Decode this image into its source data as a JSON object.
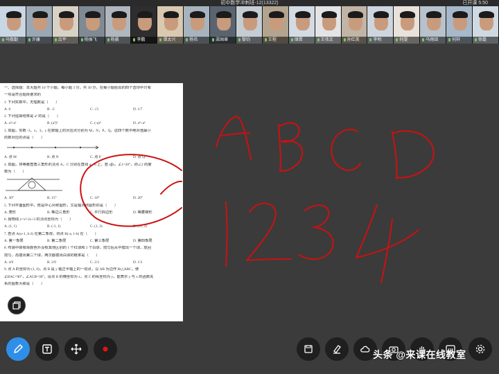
{
  "header": {
    "title": "初中数学冲刺班-12(13322)",
    "timer": "已开课 5:50"
  },
  "participants": [
    {
      "name": "马敬勤",
      "bg": "#c9d6e3"
    },
    {
      "name": "许康",
      "bg": "#9aa7b5"
    },
    {
      "name": "吕平",
      "bg": "#d8d2c6"
    },
    {
      "name": "杨振飞",
      "bg": "#7f8a94"
    },
    {
      "name": "杨晨",
      "bg": "#b0b7bf"
    },
    {
      "name": "李鹏",
      "bg": "#2e2e2e"
    },
    {
      "name": "谭太兴",
      "bg": "#d9c9b0"
    },
    {
      "name": "杨伟",
      "bg": "#a7b3be"
    },
    {
      "name": "梁国章",
      "bg": "#5a6470"
    },
    {
      "name": "黎钧",
      "bg": "#c4ccd4"
    },
    {
      "name": "王程",
      "bg": "#b2a48f"
    },
    {
      "name": "储晋",
      "bg": "#d3dbe3"
    },
    {
      "name": "王伟文",
      "bg": "#e2e4e6"
    },
    {
      "name": "孙红英",
      "bg": "#c2b5a5"
    },
    {
      "name": "李明",
      "bg": "#cdd6df"
    },
    {
      "name": "何雯",
      "bg": "#e8e2da"
    },
    {
      "name": "马雨田",
      "bg": "#b7c2cc"
    },
    {
      "name": "何轩",
      "bg": "#a6b8c9"
    },
    {
      "name": "徐磊",
      "bg": "#cfd9e2"
    }
  ],
  "document": {
    "lines": [
      {
        "t": "text",
        "v": "一、选择题：本大题共 10 个小题，每小题 3 分，共 30 分，在每小题给出的四个选项中只有"
      },
      {
        "t": "text",
        "v": "一项是符合题目要求的"
      },
      {
        "t": "text",
        "v": "1. 下列实数中，无理数是（　　）"
      },
      {
        "t": "opts",
        "v": [
          "A. 0",
          "B. -2",
          "C. √3",
          "D. 1/7"
        ]
      },
      {
        "t": "text",
        "v": "2. 下列运算结果是 a⁶ 的是（　　）"
      },
      {
        "t": "opts",
        "v": [
          "A. a³+a³",
          "B. (a³)²",
          "C. (-a)⁴",
          "D. a⁸÷a²"
        ]
      },
      {
        "t": "text",
        "v": "3. 如图，实数 -3，x，3，y 在数轴上的对应点分别为 M，N，P，Q，这四个数中绝对值最小"
      },
      {
        "t": "text",
        "v": "的数对应的点是（　　）"
      },
      {
        "t": "fig1",
        "v": ""
      },
      {
        "t": "opts",
        "v": [
          "A. 点 M",
          "B. 点 N",
          "C. 点 P",
          "D. 点 Q"
        ]
      },
      {
        "t": "text",
        "v": "4. 如图，将等腰直角三角形的顶点 A，C 分别在直线 a，b 上，若 a∥b，∠1=30°，则∠2 的度"
      },
      {
        "t": "text",
        "v": "数为（　　）"
      },
      {
        "t": "fig2",
        "v": ""
      },
      {
        "t": "opts",
        "v": [
          "A. 30°",
          "B. 15°",
          "C. 10°",
          "D. 20°"
        ]
      },
      {
        "t": "text",
        "v": "5. 下列平面图形中，既是中心对称图形，又是轴对称图形的是（　　）"
      },
      {
        "t": "opts",
        "v": [
          "A. 菱形",
          "B. 等边三角形",
          "C. 平行四边形",
          "D. 等腰梯形"
        ]
      },
      {
        "t": "text",
        "v": "6. 抛物线 y=x²-2x+3 的顶点坐标为（　　）"
      },
      {
        "t": "opts",
        "v": [
          "A. (1, 1)",
          "B. (-1, 1)",
          "C. (1, 3)",
          "D. (-1, 3)"
        ]
      },
      {
        "t": "text",
        "v": "7. 若点 A(a+1, b-2) 在第二象限，则点 B(-a, 1-b) 在（　　）"
      },
      {
        "t": "opts",
        "v": [
          "A. 第一象限",
          "B. 第二象限",
          "C. 第三象限",
          "D. 第四象限"
        ]
      },
      {
        "t": "text",
        "v": "8. 布袋中装有除颜色外没有其他区别的 1 个红球和 2 个白球，搅匀后从中摸出一个球，放回"
      },
      {
        "t": "text",
        "v": "搅匀，再摸出第二个球，两次都摸出白球的概率是（　　）"
      },
      {
        "t": "opts",
        "v": [
          "A. 4/9",
          "B. 2/9",
          "C. 2/3",
          "D. 1/3"
        ]
      },
      {
        "t": "text",
        "v": "9. 点 A 的坐标为 (1, 0)，点 B 是 y 轴正半轴上的一动点，以 AB 为边作 Rt△ABC，使"
      },
      {
        "t": "text",
        "v": "∠BAC=90°，∠ACB=30°，设点 B 的横坐标为 x，点 C 的纵坐标为 y，能表示 y 与 x 的函数关"
      },
      {
        "t": "text",
        "v": "系的图象大致是（　　）"
      }
    ]
  },
  "ink": {
    "color": "#cc1111",
    "strokes": [
      "A",
      "B",
      "C",
      "D",
      "1",
      "2",
      "3",
      "4"
    ]
  },
  "toolbar": {
    "left_tools": [
      "pen-icon",
      "text-icon",
      "move-icon",
      "record-icon"
    ],
    "right_tools": [
      "save-icon",
      "eraser-icon",
      "cloud-icon",
      "camera-icon",
      "hand-icon",
      "more-icon",
      "settings-icon"
    ],
    "record_color": "#e01515",
    "accent": "#2f8fe8"
  },
  "watermark": "头条 @来课在线教室"
}
